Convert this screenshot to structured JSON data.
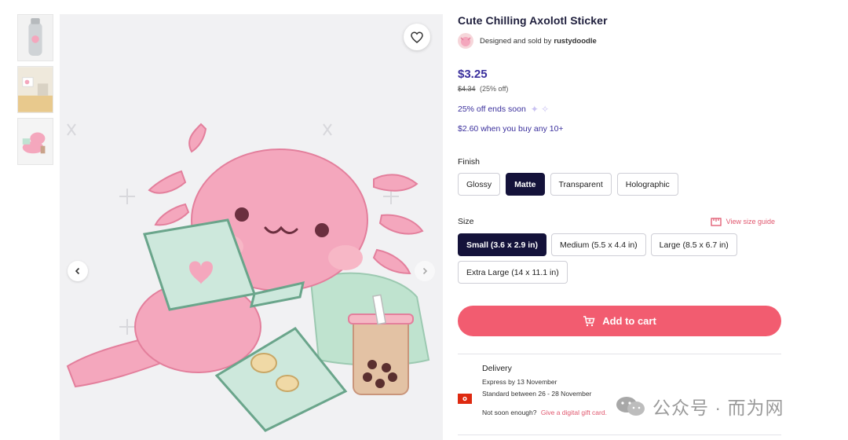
{
  "product": {
    "title": "Cute Chilling Axolotl Sticker",
    "seller_prefix": "Designed and sold by",
    "seller_name": "rustydoodle"
  },
  "pricing": {
    "price": "$3.25",
    "original_price": "$4.34",
    "discount": "(25% off)",
    "promo": "25% off ends soon",
    "bulk": "$2.60 when you buy any 10+"
  },
  "finish": {
    "label": "Finish",
    "options": [
      "Glossy",
      "Matte",
      "Transparent",
      "Holographic"
    ],
    "selected": "Matte"
  },
  "size": {
    "label": "Size",
    "guide": "View size guide",
    "options": [
      "Small (3.6 x 2.9 in)",
      "Medium (5.5 x 4.4 in)",
      "Large (8.5 x 6.7 in)",
      "Extra Large (14 x 11.1 in)"
    ],
    "selected": "Small (3.6 x 2.9 in)"
  },
  "cart": {
    "label": "Add to cart"
  },
  "delivery": {
    "title": "Delivery",
    "express": "Express by 13 November",
    "standard": "Standard between 26 - 28 November",
    "soon_prefix": "Not soon enough?",
    "soon_link": "Give a digital gift card."
  },
  "watermark": {
    "text": "公众号 · 而为网"
  },
  "colors": {
    "accent": "#f25c70",
    "price": "#3a2f9c",
    "selected_option": "#14123a",
    "axolotl_pink": "#f4a7bd"
  },
  "icons": {
    "favorite": "heart-icon",
    "prev": "chevron-left-icon",
    "cart": "cart-icon",
    "size_guide": "ruler-icon",
    "flag": "hong-kong-flag-icon"
  }
}
